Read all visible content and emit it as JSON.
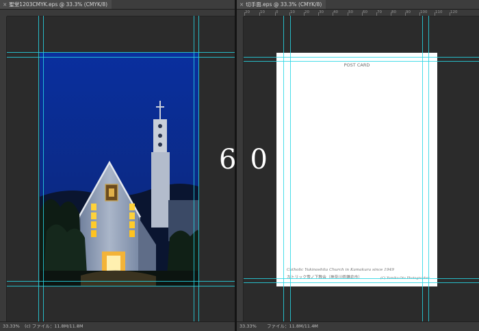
{
  "left_window": {
    "tab_title": "聖堂1203CMYK.eps @ 33.3% (CMYK/8)",
    "status": {
      "zoom": "33.33%",
      "file_label": "(c) ファイル：11.8M/11.8M"
    }
  },
  "right_window": {
    "tab_title": "切手面.eps @ 33.3% (CMYK/8)",
    "ruler_labels": [
      "20",
      "10",
      "0",
      "10",
      "20",
      "30",
      "40",
      "50",
      "60",
      "70",
      "80",
      "90",
      "100",
      "110",
      "120"
    ],
    "status": {
      "zoom": "33.33%",
      "file_label": "ファイル：11.8M/11.4M"
    },
    "postcard": {
      "heading": "POST CARD",
      "caption_en": "Catholic Yukinoshita Church in Kamakura since 1949",
      "caption_jp": "カトリック雪ノ下教会（神奈川県鎌倉市）",
      "credit": "(C) Yumiko Ota Photographer"
    }
  },
  "overlay_number": "60",
  "colors": {
    "guide": "#27d6e4",
    "canvas": "#2b2b2b",
    "sky": "#0b2a8f"
  },
  "icons": {
    "tab_close": "×",
    "status_caret": "›"
  }
}
